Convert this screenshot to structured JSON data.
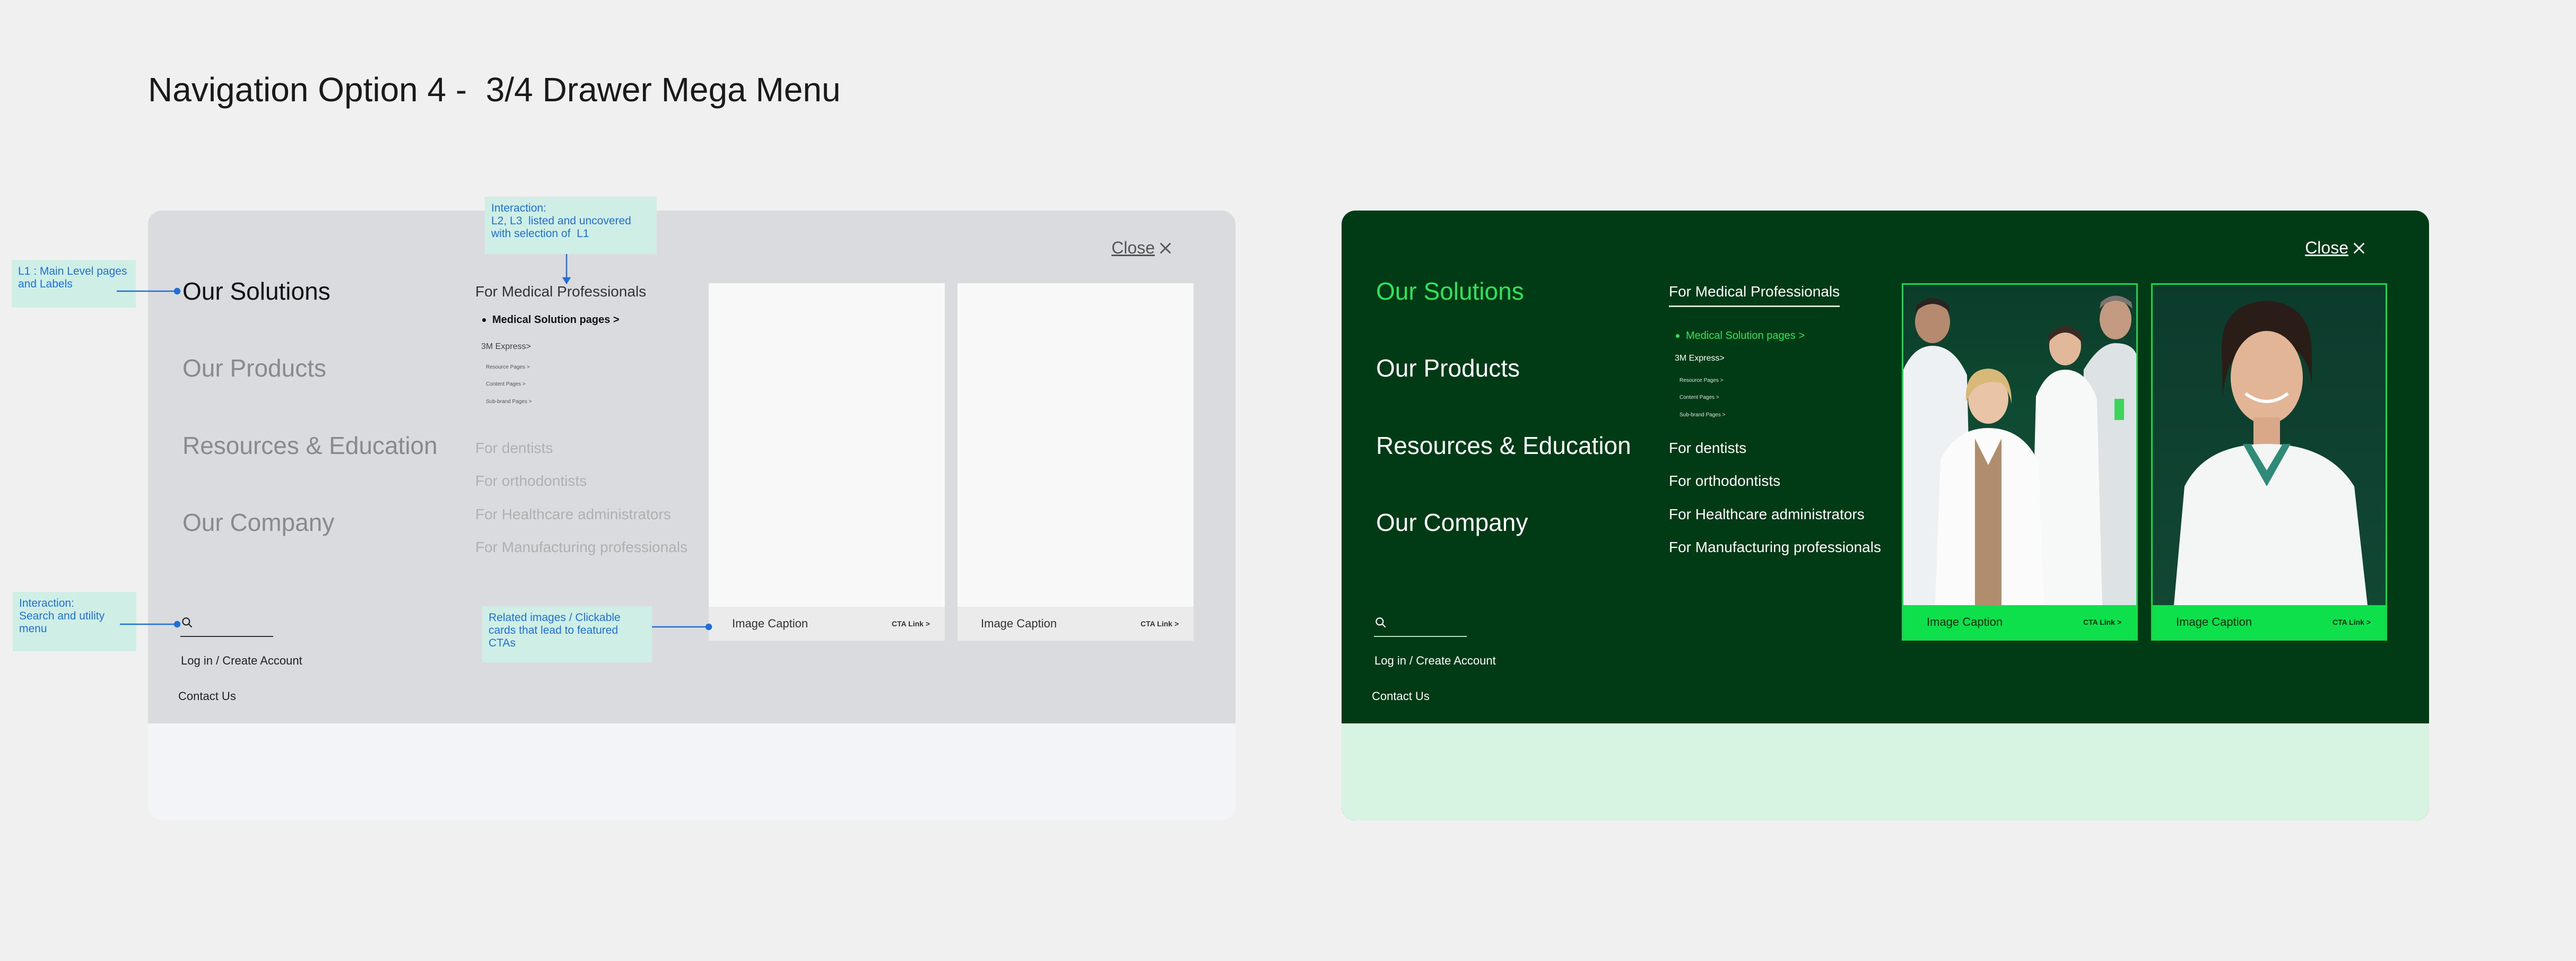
{
  "page_title": "Navigation Option 4 -  3/4 Drawer Mega Menu",
  "annotations": {
    "l1": "L1 : Main Level pages and Labels",
    "l2l3": "Interaction:\nL2, L3  listed and uncovered with selection of  L1",
    "search": "Interaction:\nSearch and utility menu",
    "cards": "Related images / Clickable cards that lead to featured CTAs"
  },
  "menu": {
    "close_label": "Close",
    "l1_items": [
      "Our Solutions",
      "Our Products",
      "Resources & Education",
      "Our Company"
    ],
    "l2_heading": "For Medical Professionals",
    "l3_main": "Medical Solution pages >",
    "l3_express": "3M Express>",
    "l3_tiny": [
      "Resource Pages >",
      "Content Pages >",
      "Sub-brand Pages >"
    ],
    "audiences": [
      "For dentists",
      "For orthodontists",
      "For Healthcare administrators",
      "For Manufacturing professionals"
    ],
    "utility": {
      "login": "Log in / Create Account",
      "contact": "Contact Us"
    },
    "cards": [
      {
        "caption": "Image Caption",
        "cta": "CTA Link >"
      },
      {
        "caption": "Image Caption",
        "cta": "CTA Link >"
      }
    ]
  },
  "colors": {
    "background": "#f0f0f0",
    "wireframe_panel": "#dadbdf",
    "dark_panel": "#003b16",
    "accent_green": "#2fe35e",
    "cta_green": "#0de04a",
    "annotation_bg": "#cfeee5",
    "annotation_text": "#1f6fd6"
  }
}
